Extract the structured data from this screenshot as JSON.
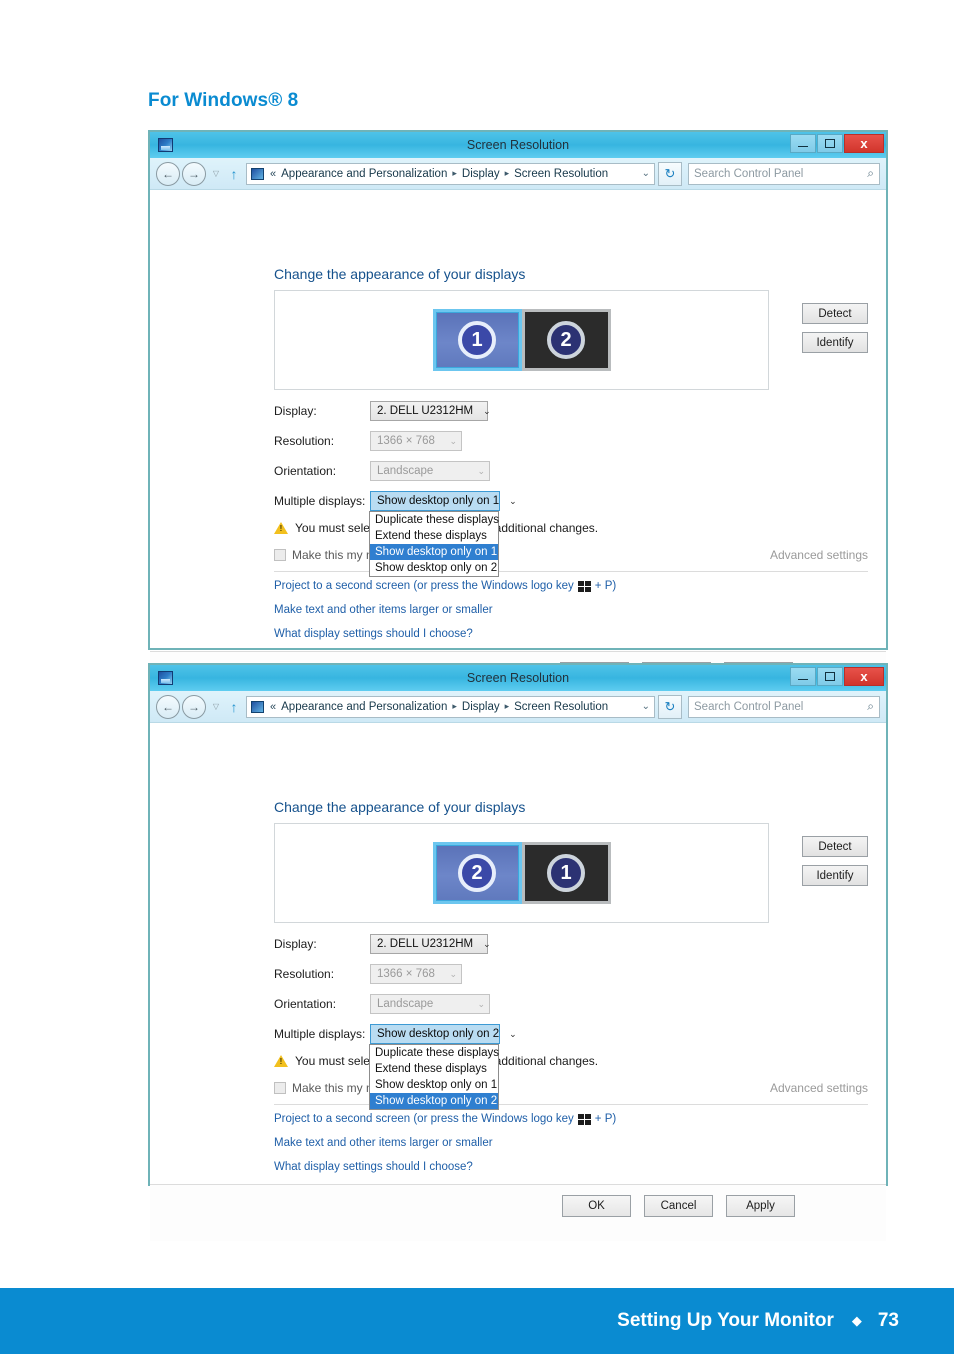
{
  "page": {
    "heading": "For Windows® 8",
    "footer": {
      "section": "Setting Up Your Monitor",
      "separator": "◆",
      "page_number": "73"
    }
  },
  "window_common": {
    "title": "Screen Resolution",
    "minimize_label": "–",
    "maximize_label": "□",
    "close_label": "x",
    "back_icon": "←",
    "forward_icon": "→",
    "history_icon": "▽",
    "up_icon": "↑",
    "address_chevrons": "«",
    "breadcrumb": [
      "Appearance and Personalization",
      "Display",
      "Screen Resolution"
    ],
    "breadcrumb_separator": "▸",
    "address_dropdown_icon": "⌄",
    "refresh_icon": "↻",
    "search_placeholder": "Search Control Panel",
    "search_icon": "⌕",
    "body_title": "Change the appearance of your displays",
    "detect_label": "Detect",
    "identify_label": "Identify",
    "display_label": "Display:",
    "display_value": "2. DELL U2312HM",
    "resolution_label": "Resolution:",
    "resolution_value": "1366 × 768",
    "orientation_label": "Orientation:",
    "orientation_value": "Landscape",
    "multiple_displays_label": "Multiple displays:",
    "warning_text": "You must select Apply before making additional changes.",
    "checkbox_label": "Make this my main display",
    "advanced_settings": "Advanced settings",
    "link_project_pre": "Project to a second screen (or press the Windows logo key",
    "link_project_post": "+ P)",
    "link_make_text": "Make text and other items larger or smaller",
    "link_what_settings": "What display settings should I choose?",
    "ok_label": "OK",
    "cancel_label": "Cancel",
    "apply_label": "Apply",
    "dropdown_options": [
      "Duplicate these displays",
      "Extend these displays",
      "Show desktop only on 1",
      "Show desktop only on 2"
    ],
    "caret_down": "⌄"
  },
  "window_top": {
    "monitors": [
      {
        "number": "1",
        "state": "active"
      },
      {
        "number": "2",
        "state": "inactive"
      }
    ],
    "multiple_displays_value": "Show desktop only on 1",
    "selected_option_index": 2
  },
  "window_bottom": {
    "monitors": [
      {
        "number": "2",
        "state": "active"
      },
      {
        "number": "1",
        "state": "inactive"
      }
    ],
    "multiple_displays_value": "Show desktop only on 2",
    "selected_option_index": 3
  },
  "colors": {
    "accent": "#0a8bd1",
    "titlebar": "#37b5e0",
    "window_border": "#6fb3b8",
    "close_button": "#d1352c",
    "selected_item": "#2f7fd0",
    "link": "#1f5fa8",
    "combo_open": "#b9dcf2"
  }
}
